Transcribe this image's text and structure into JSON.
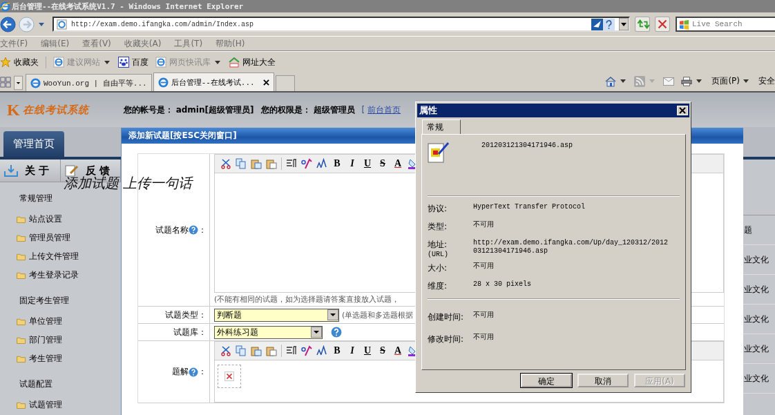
{
  "window": {
    "title": "后台管理--在线考试系统V1.7 - Windows Internet Explorer"
  },
  "address_bar": {
    "url": "http://exam.demo.ifangka.com/admin/Index.asp",
    "search_placeholder": "Live Search"
  },
  "menu_bar": [
    "文件(F)",
    "编辑(E)",
    "查看(V)",
    "收藏夹(A)",
    "工具(T)",
    "帮助(H)"
  ],
  "favorites_bar": [
    {
      "label": "收藏夹",
      "kind": "star",
      "dropdown": false
    },
    {
      "label": "建议网站",
      "kind": "ie",
      "dropdown": true
    },
    {
      "label": "百度",
      "kind": "paw",
      "dropdown": false
    },
    {
      "label": "网页快讯库",
      "kind": "ie",
      "dropdown": true
    },
    {
      "label": "网址大全",
      "kind": "house",
      "dropdown": false
    }
  ],
  "tabs": [
    {
      "label": "WooYun.org | 自由平等...",
      "selected": false
    },
    {
      "label": "后台管理--在线考试...",
      "selected": true
    }
  ],
  "command_bar": [
    "页面(P)",
    "安全"
  ],
  "site_header": {
    "logo_mark": "K",
    "logo_text": "在线考试系统",
    "account_label": "您的帐号是：",
    "account": "admin[超级管理员]",
    "rights_label": "您的权限是：",
    "rights": "超级管理员",
    "link_bracket": "[",
    "link": "前台首页"
  },
  "nav_tab": "管理首页",
  "quick_buttons": [
    {
      "label": "关 于",
      "kind": "download"
    },
    {
      "label": "反 馈",
      "kind": "edit"
    }
  ],
  "sidebar": [
    {
      "heading": "常规管理",
      "items": [
        "站点设置",
        "管理员管理",
        "上传文件管理",
        "考生登录记录"
      ]
    },
    {
      "heading": "固定考生管理",
      "items": [
        "单位管理",
        "部门管理",
        "考生管理"
      ]
    },
    {
      "heading": "试题配置",
      "items": [
        "试题管理"
      ]
    }
  ],
  "background_rows": [
    "题",
    "业文化",
    "业文化",
    "业文化",
    "业文化",
    "业文化"
  ],
  "annotation": "添加试题 上传一句话",
  "modal": {
    "title": "添加新试题[按ESC关闭窗口]",
    "fields": [
      {
        "kind": "editor",
        "label": "试题名称",
        "suffix": "：",
        "help": true,
        "hint": "(不能有相同的试题，如为选择题请答案直接放入试题，",
        "broken_image": false,
        "toolbar_letters": [
          "B",
          "I",
          "U",
          "S",
          "A"
        ]
      },
      {
        "kind": "select",
        "label": "试题类型",
        "suffix": "：",
        "help": false,
        "value": "判断题",
        "hint": "(单选题和多选题根据"
      },
      {
        "kind": "select",
        "label": "试题库",
        "suffix": "：",
        "help": true,
        "value": "外科练习题"
      },
      {
        "kind": "editor",
        "label": "题解",
        "suffix": "：",
        "help": true,
        "broken_image": true,
        "toolbar_letters": [
          "B",
          "I",
          "U",
          "S",
          "A"
        ]
      }
    ]
  },
  "properties_dialog": {
    "title": "属性",
    "tab": "常规",
    "file_name": "201203121304171946.asp",
    "sections": [
      [
        {
          "label": "协议:",
          "value": "HyperText Transfer Protocol"
        },
        {
          "label": "类型:",
          "value": "不可用"
        },
        {
          "label": "地址:",
          "sublabel": "(URL)",
          "value": "http://exam.demo.ifangka.com/Up/day_120312/201203121304171946.asp"
        },
        {
          "label": "大小:",
          "value": "不可用"
        },
        {
          "label": "维度:",
          "value": "28  x  30  pixels"
        }
      ],
      [
        {
          "label": "创建时间:",
          "value": "不可用"
        },
        {
          "label": "修改时间:",
          "value": "不可用"
        }
      ]
    ],
    "buttons": [
      {
        "label": "确定",
        "disabled": false
      },
      {
        "label": "取消",
        "disabled": false
      },
      {
        "label": "应用(A)",
        "disabled": true
      }
    ]
  }
}
